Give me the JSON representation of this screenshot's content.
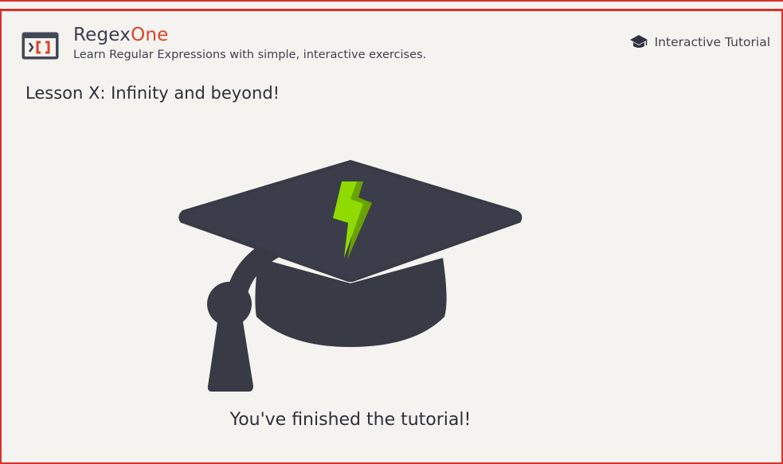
{
  "app": {
    "brand_primary": "Regex",
    "brand_accent": "One",
    "tagline": "Learn Regular Expressions with simple, interactive exercises.",
    "logo_icon": "terminal-brackets-icon",
    "accent_color": "#d9442a",
    "frame_color": "#d9302c"
  },
  "nav": {
    "tutorial_label": "Interactive Tutorial",
    "tutorial_icon": "graduation-cap-icon"
  },
  "lesson": {
    "title": "Lesson X: Infinity and beyond!",
    "illustration_icon": "graduation-cap-lightning-icon",
    "cap_color": "#383b46",
    "bolt_color": "#8fdb00",
    "message": "You've finished the tutorial!"
  }
}
